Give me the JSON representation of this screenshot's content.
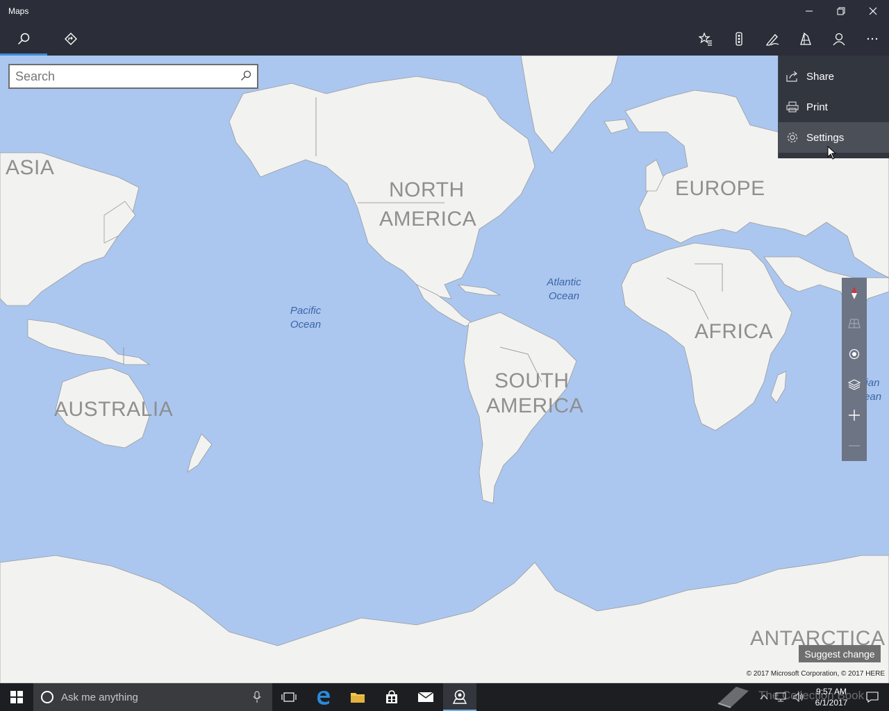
{
  "window": {
    "title": "Maps",
    "minimize_icon": "minimize-icon",
    "restore_icon": "restore-icon",
    "close_icon": "close-icon"
  },
  "appbar": {
    "nav_icons": [
      "search-icon",
      "directions-icon"
    ],
    "tool_icons": [
      "favorites-icon",
      "traffic-icon",
      "ink-icon",
      "3d-cities-icon",
      "account-icon",
      "more-icon"
    ],
    "accent_color": "#3f8ad8"
  },
  "search": {
    "placeholder": "Search"
  },
  "menu": {
    "items": [
      {
        "label": "Share",
        "icon": "share-icon"
      },
      {
        "label": "Print",
        "icon": "print-icon"
      },
      {
        "label": "Settings",
        "icon": "gear-icon"
      }
    ]
  },
  "map": {
    "labels": {
      "asia": "ASIA",
      "north_america_1": "NORTH",
      "north_america_2": "AMERICA",
      "europe": "EUROPE",
      "africa": "AFRICA",
      "south_america_1": "SOUTH",
      "south_america_2": "AMERICA",
      "australia": "AUSTRALIA",
      "antarctica": "ANTARCTICA"
    },
    "oceans": {
      "pacific_1": "Pacific",
      "pacific_2": "Ocean",
      "atlantic_1": "Atlantic",
      "atlantic_2": "Ocean",
      "indian_1": "Indian",
      "indian_2": "Ocean"
    },
    "water_color": "#abc7f0",
    "land_color": "#f2f2f0"
  },
  "controls": {
    "icons": [
      "compass-icon",
      "tilt-icon",
      "locate-icon",
      "layers-icon",
      "zoom-in-icon",
      "zoom-out-icon"
    ]
  },
  "footer": {
    "suggest_label": "Suggest change",
    "copyright": "© 2017 Microsoft Corporation, © 2017 HERE"
  },
  "taskbar": {
    "search_placeholder": "Ask me anything",
    "time": "9:57 AM",
    "date": "6/1/2017",
    "watermark": "The Collection Book"
  }
}
